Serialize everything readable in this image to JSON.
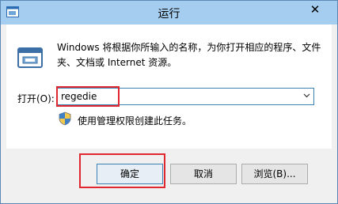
{
  "window": {
    "title": "运行",
    "close_glyph": "✕"
  },
  "dialog": {
    "description": "Windows 将根据你所输入的名称，为你打开相应的程序、文件夹、文档或 Internet 资源。",
    "open_label": "打开(O):",
    "open_value": "regedie",
    "admin_note": "使用管理权限创建此任务。"
  },
  "buttons": {
    "ok": "确定",
    "cancel": "取消",
    "browse": "浏览(B)..."
  },
  "icons": {
    "app": "run-app-icon",
    "run": "run-dialog-icon",
    "shield": "uac-shield-icon",
    "dropdown": "chevron-down-icon"
  },
  "annotations": {
    "highlight_color": "#e0262f"
  }
}
